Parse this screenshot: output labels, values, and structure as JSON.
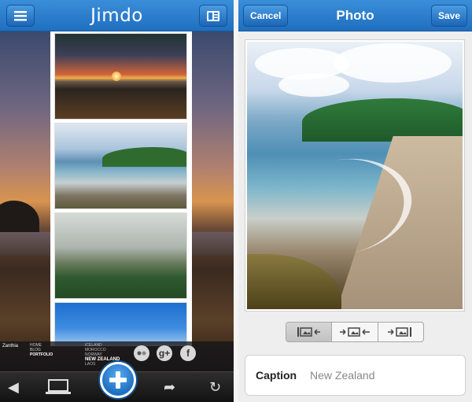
{
  "left": {
    "brand": "Jimdo",
    "footer": {
      "brand": "Zanthia",
      "nav": [
        "HOME",
        "BLOG",
        "PORTFOLIO"
      ],
      "nav_active": "PORTFOLIO",
      "countries": [
        "ICELAND",
        "MOROCCO",
        "NORWAY",
        "NEW ZEALAND",
        "LAOS"
      ],
      "country_active": "NEW ZEALAND",
      "social": {
        "gplus": "g+",
        "facebook": "f"
      }
    },
    "icons": {
      "menu": "hamburger-icon",
      "layout": "layout-icon",
      "back": "back-arrow-icon",
      "device": "laptop-icon",
      "add": "plus-icon",
      "share": "share-icon",
      "refresh": "refresh-icon"
    },
    "glyphs": {
      "back": "◀",
      "share": "➦",
      "refresh": "↻",
      "add": "+"
    }
  },
  "right": {
    "title": "Photo",
    "cancel_label": "Cancel",
    "save_label": "Save",
    "alignment": {
      "options": [
        "align-left",
        "align-center",
        "align-right"
      ],
      "selected": "align-left"
    },
    "caption": {
      "label": "Caption",
      "value": "New Zealand"
    }
  },
  "colors": {
    "accent": "#2a7fd0",
    "bar_dark": "#1b1b1b",
    "panel_bg": "#eeeeee"
  }
}
